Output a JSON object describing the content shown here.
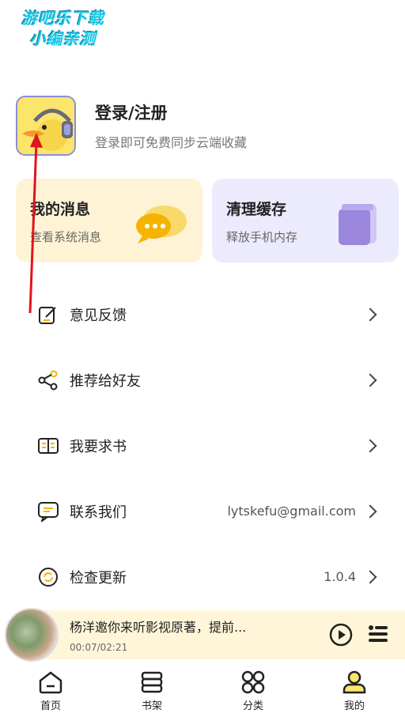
{
  "watermark": {
    "line1": "游吧乐下载",
    "line2": "小编亲测"
  },
  "profile": {
    "title": "登录/注册",
    "subtitle": "登录即可免费同步云端收藏",
    "avatar_icon": "duck-headphones-avatar"
  },
  "cards": [
    {
      "title": "我的消息",
      "subtitle": "查看系统消息",
      "icon": "message-bubble-icon",
      "bg": "#fff3d6"
    },
    {
      "title": "清理缓存",
      "subtitle": "释放手机内存",
      "icon": "trash-cup-icon",
      "bg": "#ecebfd"
    }
  ],
  "menu": [
    {
      "label": "意见反馈",
      "value": "",
      "icon": "feedback-edit-icon"
    },
    {
      "label": "推荐给好友",
      "value": "",
      "icon": "share-icon"
    },
    {
      "label": "我要求书",
      "value": "",
      "icon": "book-request-icon"
    },
    {
      "label": "联系我们",
      "value": "lytskefu@gmail.com",
      "icon": "contact-message-icon"
    },
    {
      "label": "检查更新",
      "value": "1.0.4",
      "icon": "update-refresh-icon"
    }
  ],
  "player": {
    "title": "杨洋邀你来听影视原著，提前...",
    "time": "00:07/02:21"
  },
  "tabs": [
    {
      "label": "首页",
      "icon": "home-icon"
    },
    {
      "label": "书架",
      "icon": "bookshelf-icon"
    },
    {
      "label": "分类",
      "icon": "category-icon"
    },
    {
      "label": "我的",
      "icon": "profile-icon"
    }
  ],
  "colors": {
    "accent": "#fbe56b",
    "msg_card": "#fff3d6",
    "clean_card": "#ecebfd",
    "player_bg": "#fff6d9",
    "arrow": "#e0141c"
  }
}
